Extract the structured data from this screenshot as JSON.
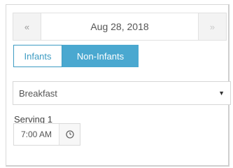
{
  "date_nav": {
    "prev_label": "«",
    "date": "Aug 28, 2018",
    "next_label": "»"
  },
  "toggle": {
    "infants_label": "Infants",
    "non_infants_label": "Non-Infants",
    "selected": "Non-Infants",
    "accent_color": "#4aa8d0"
  },
  "meal_select": {
    "value": "Breakfast"
  },
  "serving": {
    "label": "Serving 1",
    "time": "7:00 AM",
    "icon": "clock-icon"
  }
}
